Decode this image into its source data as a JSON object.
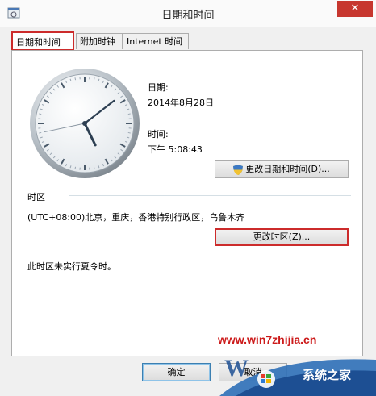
{
  "window": {
    "title": "日期和时间",
    "close_symbol": "✕"
  },
  "tabs": [
    {
      "label": "日期和时间",
      "active": true
    },
    {
      "label": "附加时钟",
      "active": false
    },
    {
      "label": "Internet 时间",
      "active": false
    }
  ],
  "datetime": {
    "date_label": "日期:",
    "date_value": "2014年8月28日",
    "time_label": "时间:",
    "time_value": "下午 5:08:43",
    "change_button": "更改日期和时间(D)..."
  },
  "timezone": {
    "section_label": "时区",
    "value": "(UTC+08:00)北京，重庆，香港特别行政区，乌鲁木齐",
    "change_button": "更改时区(Z)...",
    "dst_note": "此时区未实行夏令时。"
  },
  "footer": {
    "ok_button": "确定",
    "cancel_button": "取消"
  },
  "watermark": {
    "url": "www.win7zhijia.cn",
    "site_name": "系统之家"
  },
  "colors": {
    "highlight_red": "#cc2b2b",
    "window_bg": "#f0f0f0",
    "panel_bg": "#ffffff",
    "watermark_red": "#cc1a1a"
  },
  "clock": {
    "hour": 5,
    "minute": 8,
    "second": 43
  }
}
